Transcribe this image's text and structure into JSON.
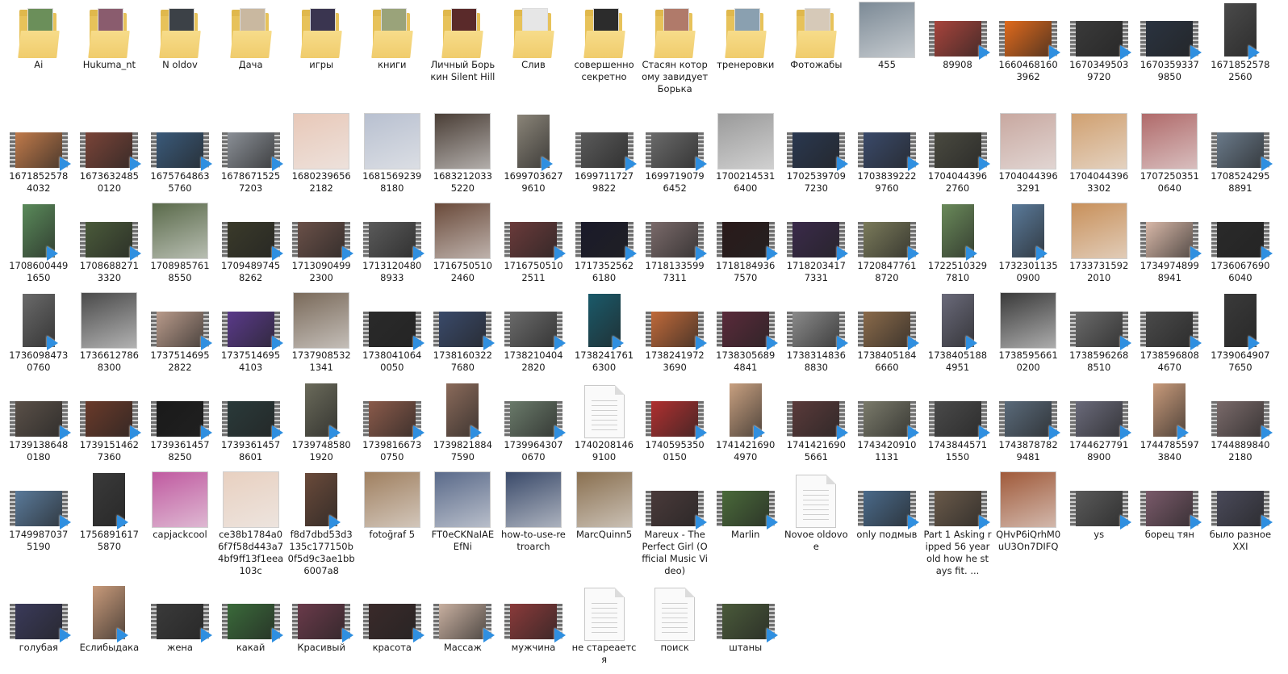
{
  "window": {
    "view": "Large icons"
  },
  "colors": {
    "folder": "#e7c25a",
    "play": "#2f8fe0",
    "selection": "#cce8ff"
  },
  "items": [
    {
      "label": "Ai",
      "type": "folder",
      "tint": "#6b8f5a"
    },
    {
      "label": "Hukuma_nt",
      "type": "folder",
      "tint": "#8a5c6e"
    },
    {
      "label": "N oldov",
      "type": "folder",
      "tint": "#3c4147"
    },
    {
      "label": "Дача",
      "type": "folder",
      "tint": "#c9b8a0"
    },
    {
      "label": "игры",
      "type": "folder",
      "tint": "#3a3550"
    },
    {
      "label": "книги",
      "type": "folder",
      "tint": "#9aa37a"
    },
    {
      "label": "Личный Борькин Silent Hill",
      "type": "folder",
      "tint": "#5a2a2a"
    },
    {
      "label": "Слив",
      "type": "folder",
      "tint": "#e6e6e6"
    },
    {
      "label": "совершенно секретно",
      "type": "folder",
      "tint": "#2c2c2c"
    },
    {
      "label": "Стасян которому завидует Борька",
      "type": "folder",
      "tint": "#b07a6a"
    },
    {
      "label": "тренеровки",
      "type": "folder",
      "tint": "#8aa0b0"
    },
    {
      "label": "Фотожабы",
      "type": "folder",
      "tint": "#d6c9b8"
    },
    {
      "label": "455",
      "type": "image",
      "tint": "#7c8a96"
    },
    {
      "label": "89908",
      "type": "video",
      "tint": "#a8443c"
    },
    {
      "label": "1660468160 3962",
      "type": "video",
      "tint": "#e06a1c"
    },
    {
      "label": "1670349503 9720",
      "type": "video",
      "tint": "#3a3a3a"
    },
    {
      "label": "1670359337 9850",
      "type": "video",
      "tint": "#2a3340"
    },
    {
      "label": "1671852578 2560",
      "type": "tallvideo",
      "tint": "#4a4a4a"
    },
    {
      "label": "",
      "type": "blank"
    },
    {
      "label": "1671852578 4032",
      "type": "video",
      "tint": "#c07a4a"
    },
    {
      "label": "1673632485 0120",
      "type": "video",
      "tint": "#7a4438"
    },
    {
      "label": "1675764863 5760",
      "type": "video",
      "tint": "#3a5a7a"
    },
    {
      "label": "1678671525 7203",
      "type": "video",
      "tint": "#8a8f96"
    },
    {
      "label": "1680239656 2182",
      "type": "image",
      "tint": "#e8c8b8"
    },
    {
      "label": "1681569239 8180",
      "type": "image",
      "tint": "#b8c0d0"
    },
    {
      "label": "1683212033 5220",
      "type": "image",
      "tint": "#4a3e36"
    },
    {
      "label": "1699703627 9610",
      "type": "tallvideo",
      "tint": "#8a8478"
    },
    {
      "label": "1699711727 9822",
      "type": "video",
      "tint": "#5a5a5a"
    },
    {
      "label": "1699719079 6452",
      "type": "video",
      "tint": "#6a6a6a"
    },
    {
      "label": "1700214531 6400",
      "type": "image",
      "tint": "#9a9a9a"
    },
    {
      "label": "1702539709 7230",
      "type": "video",
      "tint": "#2a3850"
    },
    {
      "label": "1703839222 9760",
      "type": "video",
      "tint": "#3a4a6a"
    },
    {
      "label": "1704044396 2760",
      "type": "video",
      "tint": "#4a4a40"
    },
    {
      "label": "1704044396 3291",
      "type": "image",
      "tint": "#c8a8a0"
    },
    {
      "label": "1704044396 3302",
      "type": "image",
      "tint": "#d0a070"
    },
    {
      "label": "1707250351 0640",
      "type": "image",
      "tint": "#b06a6a"
    },
    {
      "label": "1708524295 8891",
      "type": "video",
      "tint": "#6a7a8a"
    },
    {
      "label": "",
      "type": "blank"
    },
    {
      "label": "1708600449 1650",
      "type": "tallvideo",
      "tint": "#5a8a5a"
    },
    {
      "label": "1708688271 3320",
      "type": "video",
      "tint": "#4a5a3a"
    },
    {
      "label": "1708985761 8550",
      "type": "image",
      "tint": "#5a6a4a"
    },
    {
      "label": "1709489745 8262",
      "type": "video",
      "tint": "#3a3a2a"
    },
    {
      "label": "1713090499 2300",
      "type": "video",
      "tint": "#6a5048"
    },
    {
      "label": "1713120480 8933",
      "type": "video",
      "tint": "#5a5a5a"
    },
    {
      "label": "1716750510 2460",
      "type": "image",
      "tint": "#6a4a3a"
    },
    {
      "label": "1716750510 2511",
      "type": "video",
      "tint": "#6a3a3a"
    },
    {
      "label": "1717352562 6180",
      "type": "video",
      "tint": "#1a1a2a"
    },
    {
      "label": "1718133599 7311",
      "type": "video",
      "tint": "#7a6a6a"
    },
    {
      "label": "1718184936 7570",
      "type": "video",
      "tint": "#2a1a1a"
    },
    {
      "label": "1718203417 7331",
      "type": "video",
      "tint": "#3a2a4a"
    },
    {
      "label": "1720847761 8720",
      "type": "video",
      "tint": "#7a7a5a"
    },
    {
      "label": "1722510329 7810",
      "type": "tallvideo",
      "tint": "#6a8a5a"
    },
    {
      "label": "1732301135 0900",
      "type": "tallvideo",
      "tint": "#5a7a9a"
    },
    {
      "label": "1733731592 2010",
      "type": "image",
      "tint": "#c8905a"
    },
    {
      "label": "1734974899 8941",
      "type": "video",
      "tint": "#d8b8a8"
    },
    {
      "label": "1736067690 6040",
      "type": "video",
      "tint": "#2a2a2a"
    },
    {
      "label": "",
      "type": "blank"
    },
    {
      "label": "1736098473 0760",
      "type": "tallvideo",
      "tint": "#6a6a6a"
    },
    {
      "label": "1736612786 8300",
      "type": "image",
      "tint": "#4a4a4a"
    },
    {
      "label": "1737514695 2822",
      "type": "video",
      "tint": "#b89a8a"
    },
    {
      "label": "1737514695 4103",
      "type": "video",
      "tint": "#5a3a8a"
    },
    {
      "label": "1737908532 1341",
      "type": "image",
      "tint": "#7a6a5a"
    },
    {
      "label": "1738041064 0050",
      "type": "video",
      "tint": "#2a2a2a"
    },
    {
      "label": "1738160322 7680",
      "type": "video",
      "tint": "#3a4a6a"
    },
    {
      "label": "1738210404 2820",
      "type": "video",
      "tint": "#6a6a6a"
    },
    {
      "label": "1738241761 6300",
      "type": "tallvideo",
      "tint": "#1a5a6a"
    },
    {
      "label": "1738241972 3690",
      "type": "video",
      "tint": "#c06a3a"
    },
    {
      "label": "1738305689 4841",
      "type": "video",
      "tint": "#5a2a3a"
    },
    {
      "label": "1738314836 8830",
      "type": "video",
      "tint": "#8a8a8a"
    },
    {
      "label": "1738405184 6660",
      "type": "video",
      "tint": "#8a6a4a"
    },
    {
      "label": "1738405188 4951",
      "type": "tallvideo",
      "tint": "#6a6a7a"
    },
    {
      "label": "1738595661 0200",
      "type": "image",
      "tint": "#3a3a3a"
    },
    {
      "label": "1738596268 8510",
      "type": "video",
      "tint": "#6a6a6a"
    },
    {
      "label": "1738596808 4670",
      "type": "video",
      "tint": "#4a4a4a"
    },
    {
      "label": "1739064907 7650",
      "type": "tallvideo",
      "tint": "#3a3a3a"
    },
    {
      "label": "",
      "type": "blank"
    },
    {
      "label": "1739138648 0180",
      "type": "video",
      "tint": "#5a5048"
    },
    {
      "label": "1739151462 7360",
      "type": "video",
      "tint": "#6a3a2a"
    },
    {
      "label": "1739361457 8250",
      "type": "video",
      "tint": "#1a1a1a"
    },
    {
      "label": "1739361457 8601",
      "type": "video",
      "tint": "#2a3a3a"
    },
    {
      "label": "1739748580 1920",
      "type": "tallvideo",
      "tint": "#6a6a5a"
    },
    {
      "label": "1739816673 0750",
      "type": "video",
      "tint": "#8a5a4a"
    },
    {
      "label": "1739821884 7590",
      "type": "tallvideo",
      "tint": "#8a6a5a"
    },
    {
      "label": "1739964307 0670",
      "type": "video",
      "tint": "#6a7a6a"
    },
    {
      "label": "1740208146 9100",
      "type": "doc",
      "tint": "#ffffff"
    },
    {
      "label": "1740595350 0150",
      "type": "video",
      "tint": "#b03030"
    },
    {
      "label": "1741421690 4970",
      "type": "tallvideo",
      "tint": "#c8a080"
    },
    {
      "label": "1741421690 5661",
      "type": "video",
      "tint": "#5a3a3a"
    },
    {
      "label": "1743420910 1131",
      "type": "video",
      "tint": "#7a7a6a"
    },
    {
      "label": "1743844571 1550",
      "type": "video",
      "tint": "#4a4a4a"
    },
    {
      "label": "1743878782 9481",
      "type": "video",
      "tint": "#5a6a7a"
    },
    {
      "label": "1744627791 8900",
      "type": "video",
      "tint": "#6a6a7a"
    },
    {
      "label": "1744785597 3840",
      "type": "tallvideo",
      "tint": "#c89a7a"
    },
    {
      "label": "1744889840 2180",
      "type": "video",
      "tint": "#7a6a6a"
    },
    {
      "label": "",
      "type": "blank"
    },
    {
      "label": "1749987037 5190",
      "type": "video",
      "tint": "#5a7a9a"
    },
    {
      "label": "1756891617 5870",
      "type": "tallvideo",
      "tint": "#3a3a3a"
    },
    {
      "label": "capjackcool",
      "type": "image",
      "tint": "#c05aa0"
    },
    {
      "label": "ce38b1784a06f7f58d443a74bf9ff13f1eea103c",
      "type": "image",
      "tint": "#e8d0c0"
    },
    {
      "label": "f8d7dbd53d3135c177150b0f5d9c3ae1bb6007a8",
      "type": "tallvideo",
      "tint": "#6a4a3a"
    },
    {
      "label": "fotoğraf 5",
      "type": "image",
      "tint": "#a08060"
    },
    {
      "label": "FT0eCKNaIAEEfNi",
      "type": "image",
      "tint": "#5a6a8a"
    },
    {
      "label": "how-to-use-retroarch",
      "type": "image",
      "tint": "#3a4a6a"
    },
    {
      "label": "MarcQuinn5",
      "type": "image",
      "tint": "#8a7050"
    },
    {
      "label": "Mareux - The Perfect Girl (Official Music Video)",
      "type": "video",
      "tint": "#4a3a3a"
    },
    {
      "label": "Marlin",
      "type": "video",
      "tint": "#4a6a3a"
    },
    {
      "label": "Novoe oldovoe",
      "type": "doc",
      "tint": "#ffffff"
    },
    {
      "label": "only подмыв",
      "type": "video",
      "tint": "#4a6a8a"
    },
    {
      "label": "Part 1 Asking ripped 56 year old how he stays fit. ...",
      "type": "video",
      "tint": "#6a5a4a"
    },
    {
      "label": "QHvP6iQrhM0uU3On7DIFQ",
      "type": "image",
      "tint": "#a05a3a"
    },
    {
      "label": "ys",
      "type": "video",
      "tint": "#5a5a5a"
    },
    {
      "label": "борец тян",
      "type": "video",
      "tint": "#7a5a6a"
    },
    {
      "label": "было разное XXI",
      "type": "video",
      "tint": "#4a4a5a"
    },
    {
      "label": "",
      "type": "blank"
    },
    {
      "label": "голубая",
      "type": "video",
      "tint": "#3a3a5a"
    },
    {
      "label": "Еслибыдака",
      "type": "tallvideo",
      "tint": "#c89a7a"
    },
    {
      "label": "жена",
      "type": "video",
      "tint": "#3a3a3a"
    },
    {
      "label": "какай",
      "type": "video",
      "tint": "#3a6a3a"
    },
    {
      "label": "Красивый",
      "type": "video",
      "tint": "#6a3a4a"
    },
    {
      "label": "красота",
      "type": "video",
      "tint": "#3a2a2a"
    },
    {
      "label": "Массаж",
      "type": "video",
      "tint": "#c8b0a0"
    },
    {
      "label": "мужчина",
      "type": "video",
      "tint": "#8a3a3a"
    },
    {
      "label": "не стареается",
      "type": "doc",
      "tint": "#ffffff"
    },
    {
      "label": "поиск",
      "type": "doc",
      "tint": "#ffffff"
    },
    {
      "label": "штаны",
      "type": "video",
      "tint": "#4a5a3a"
    }
  ]
}
